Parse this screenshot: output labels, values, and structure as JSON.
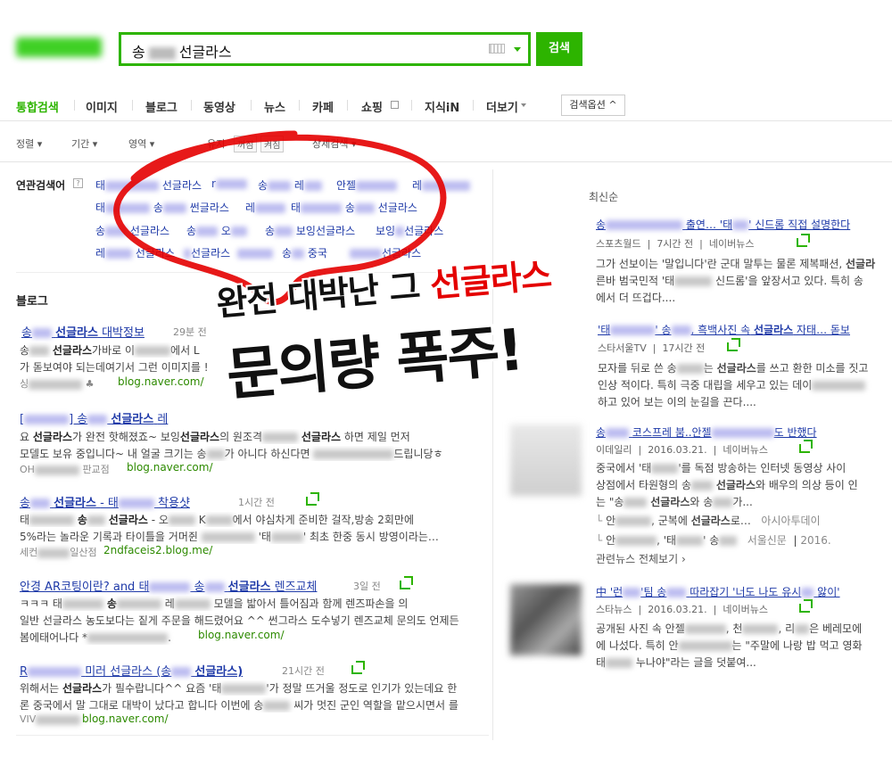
{
  "search": {
    "query_prefix": "송",
    "query_suffix": "선글라스",
    "button": "검색"
  },
  "tabs": [
    "통합검색",
    "이미지",
    "블로그",
    "동영상",
    "뉴스",
    "카페",
    "쇼핑",
    "지식iN",
    "더보기"
  ],
  "search_options": "검색옵션",
  "filters": {
    "sort": "정렬",
    "period": "기간",
    "area": "영역",
    "keep": "유지",
    "off": "꺼짐",
    "on": "켜짐",
    "detail": "상세검색"
  },
  "related": {
    "label": "연관검색어",
    "help": "?",
    "row1": [
      "태",
      "선글라스",
      "r",
      "송",
      "레",
      "안젤",
      "레"
    ],
    "row2": [
      "태",
      "송",
      "썬글라스",
      "레",
      "태",
      "송",
      "선글라스"
    ],
    "row3": [
      "송",
      "선글라스",
      "송",
      "오",
      "송",
      "보잉선글라스",
      "보잉",
      "선글라스"
    ],
    "row4": [
      "레",
      "선글라스",
      "선글라스",
      "송",
      "중국",
      "선글라스"
    ]
  },
  "blog": {
    "section_title": "블로그",
    "items": [
      {
        "title_a": "송",
        "title_b": "선글라스",
        "title_c": "대박정보",
        "time": "29분 전",
        "line1_a": "송",
        "line1_b": "선글라스",
        "line1_c": "가바로 이",
        "line1_d": "에서 L",
        "line2": "가 돋보여야 되는데여기서 그런 이미지를 !",
        "source": "싱",
        "url": "blog.naver.com/"
      },
      {
        "title_a": "[",
        "title_b": "] 송",
        "title_c": "선글라스",
        "title_d": "레",
        "line1_a": "요",
        "line1_b": "선글라스",
        "line1_c": "가 완전 핫해졌죠~ 보잉",
        "line1_d": "선글라스",
        "line1_e": "의 원조격",
        "line1_f": "선글라스",
        "line1_g": "하면 제일 먼저",
        "line2_a": "모델도 보유 중입니다~ 내 얼굴 크기는 송",
        "line2_b": "가 아니다 하신다면",
        "line2_c": "드립니당ㅎ",
        "source_a": "OH",
        "source_b": "판교점",
        "url": "blog.naver.com/"
      },
      {
        "title_a": "송",
        "title_b": "선글라스",
        "title_c": "- 태",
        "title_d": "착용샷",
        "time": "1시간 전",
        "line1_a": "태",
        "line1_b": "송",
        "line1_c": "선글라스",
        "line1_d": "- 오",
        "line1_e": "K",
        "line1_f": "에서 야심차게 준비한 걸작,방송 2회만에",
        "line2_a": "5%라는 놀라운 기록과 타이틀을 거머쥔",
        "line2_b": "'태",
        "line2_c": "' 최초 한중 동시 방영이라는…",
        "source_a": "세컨",
        "source_b": "일산점",
        "url": "2ndfaceis2.blog.me/"
      },
      {
        "title_a": "안경 AR코팅이란? and 태",
        "title_b": "송",
        "title_c": "선글라스",
        "title_d": "렌즈교체",
        "time": "3일 전",
        "line1_a": "ㅋㅋㅋ 태",
        "line1_b": "송",
        "line1_c": "레",
        "line1_d": "모델을 밟아서 틀어짐과 함께 렌즈파손을 의",
        "line2": "일반 선글라스 농도보다는 짙게 주문을 해드렸어요 ^^ 썬그라스 도수넣기 렌즈교체 문의도 언제든",
        "line3_a": "봄에태어나다 *",
        "url": "blog.naver.com/"
      },
      {
        "title_a": "R",
        "title_b": "미러 선글라스 (송",
        "title_c": "선글라스)",
        "time": "21시간 전",
        "line1_a": "위해서는",
        "line1_b": "선글라스",
        "line1_c": "가 필수랍니다^^ 요즘 '태",
        "line1_d": "'가 정말 뜨거울 정도로 인기가 있는데요 한",
        "line2_a": "론 중국에서 말 그대로 대박이 났다고 합니다 이번에 송",
        "line2_b": "씨가 멋진 군인 역할을 맡으시면서 를",
        "source": "VIV",
        "url": "blog.naver.com/"
      }
    ]
  },
  "news": {
    "latest_label": "최신순",
    "items": [
      {
        "title_a": "송",
        "title_b": "출연… '태",
        "title_c": "' 신드롬 직접 설명한다",
        "press": "스포츠월드",
        "time": "7시간 전",
        "portal": "네이버뉴스",
        "line1_a": "그가 선보이는 '말입니다'란 군대 말투는 물론 제복패션,",
        "line1_b": "선글라",
        "line2_a": "른바 범국민적 '태",
        "line2_b": "신드롬'을 앞장서고 있다. 특히 송",
        "line3": "에서 더 뜨겁다...."
      },
      {
        "title_a": "'태",
        "title_b": "' 송",
        "title_c": ", 흑백사진 속",
        "title_d": "선글라스",
        "title_e": "자태… 돋보",
        "press": "스타서울TV",
        "time": "17시간 전",
        "line1_a": "모자를 뒤로 쓴 송",
        "line1_b": "는",
        "line1_c": "선글라스",
        "line1_d": "를 쓰고 환한 미소를 짓고",
        "line2_a": "인상 적이다. 특히 극중 대립을 세우고 있는 데이",
        "line3": "하고 있어 보는 이의 눈길을 끈다...."
      },
      {
        "title_a": "송",
        "title_b": "코스프레 붐..안젤",
        "title_c": "도 반했다",
        "press": "이데일리",
        "date": "2016.03.21.",
        "portal": "네이버뉴스",
        "line1_a": "중국에서 '태",
        "line1_b": "'를 독점 방송하는 인터넷 동영상 사이",
        "line2_a": "상점에서 타원형의 송",
        "line2_b": "선글라스",
        "line2_c": "와 배우의 의상 등이 인",
        "line3_a": "는 \"송",
        "line3_b": "선글라스",
        "line3_c": "와 송",
        "line3_d": "가...",
        "rel1_a": "안",
        "rel1_b": ", 군복에",
        "rel1_c": "선글라스",
        "rel1_d": "로…",
        "rel1_press": "아시아투데이",
        "rel2_a": "안",
        "rel2_b": ", '태",
        "rel2_c": "' 송",
        "rel2_press": "서울신문",
        "rel2_date": "2016.",
        "all": "관련뉴스 전체보기"
      },
      {
        "title_a": "中 '런",
        "title_b": "'팀 송",
        "title_c": "따라잡기 '너도 나도 유시",
        "title_d": "앓이'",
        "press": "스타뉴스",
        "date": "2016.03.21.",
        "portal": "네이버뉴스",
        "line1_a": "공개된 사진 속 안젤",
        "line1_b": ", 천",
        "line1_c": ", 리",
        "line1_d": "은 베레모에",
        "line2_a": "에 나섰다. 특히 안",
        "line2_b": "는 \"주말에 나랑 밥 먹고 영화",
        "line3_a": "태",
        "line3_b": "누나야\"라는 글을 덧붙여..."
      }
    ]
  },
  "overlay": {
    "line1_a": "완전 대박난 그",
    "line1_b": "선글라스",
    "line2": "문의량 폭주!"
  },
  "colors": {
    "brand": "#2db400",
    "link": "#1f3aa8",
    "url": "#2d8a00",
    "accent_red": "#e40000"
  }
}
